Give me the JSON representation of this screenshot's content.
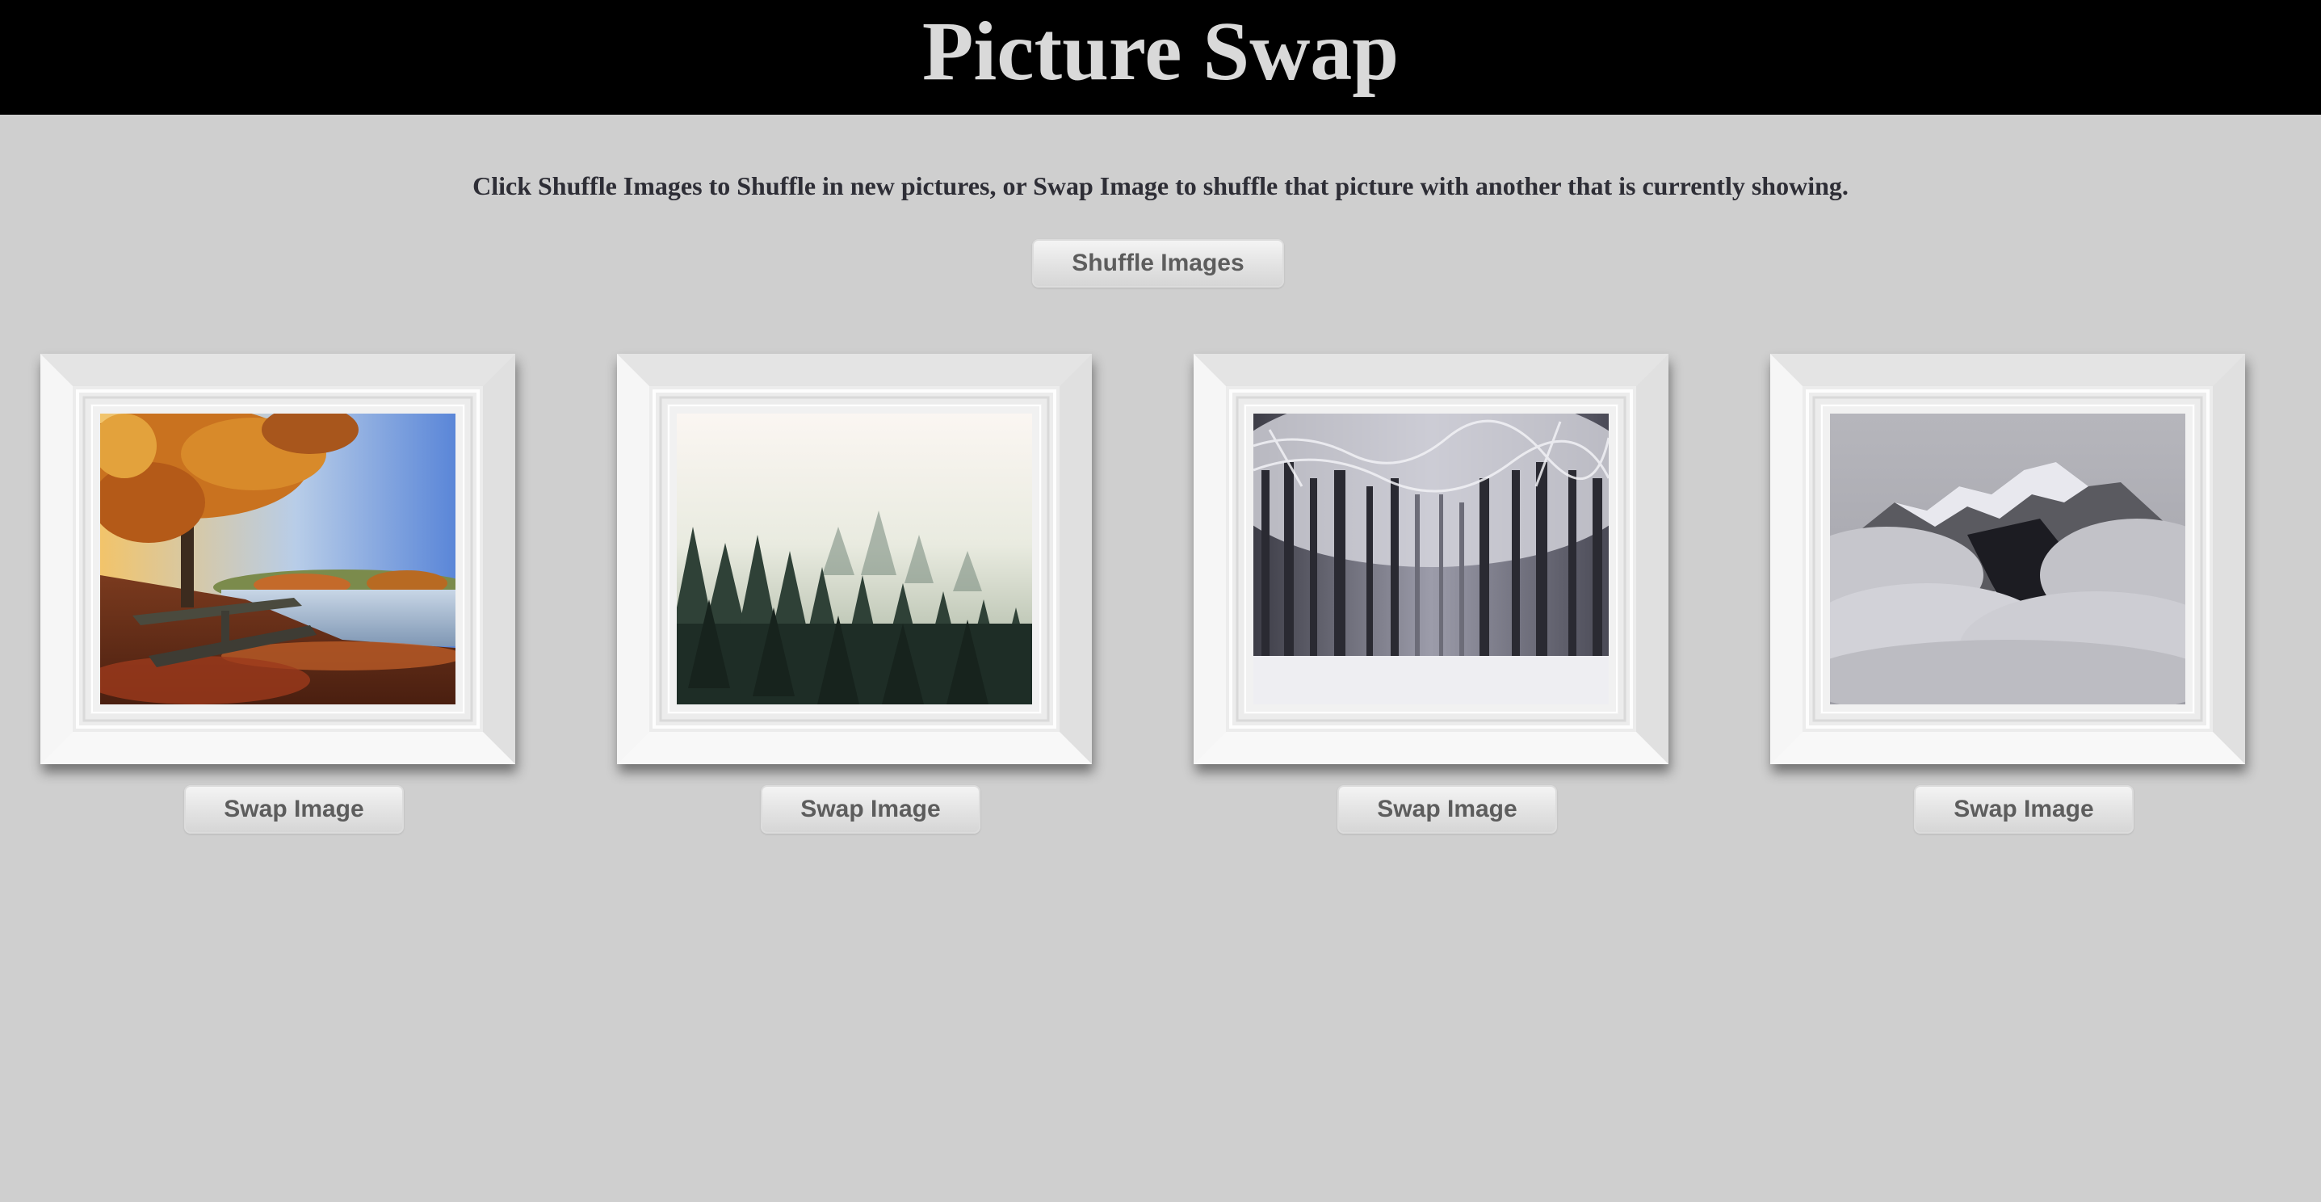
{
  "header": {
    "title": "Picture Swap"
  },
  "instructions": "Click Shuffle Images to Shuffle in new pictures, or Swap Image to shuffle that picture with another that is currently showing.",
  "shuffle_button": {
    "label": "Shuffle Images"
  },
  "pictures": [
    {
      "swap_label": "Swap Image"
    },
    {
      "swap_label": "Swap Image"
    },
    {
      "swap_label": "Swap Image"
    },
    {
      "swap_label": "Swap Image"
    }
  ],
  "colors": {
    "header_bg": "#000000",
    "title_text": "#d9d9d9",
    "page_bg": "#cfcfcf",
    "frame": "#eeeeee",
    "button_text": "#5d5d5d"
  }
}
